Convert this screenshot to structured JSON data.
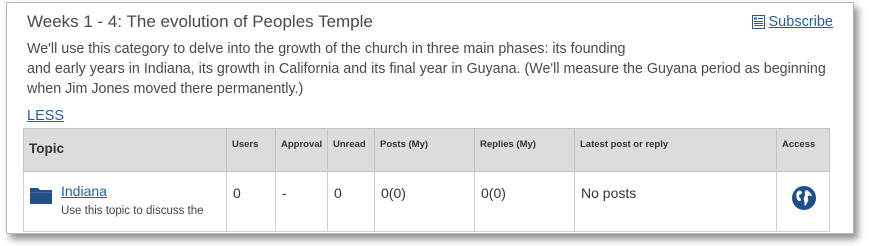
{
  "category": {
    "title": "Weeks 1 - 4: The evolution of Peoples Temple",
    "subscribe_label": "Subscribe",
    "description_lines": [
      "We'll use this category to delve into the growth of the church in three main phases: its founding",
      "and early years in Indiana, its growth in California and its final year in Guyana. (We'll measure the Guyana period as beginning when Jim Jones moved there permanently.)"
    ],
    "less_label": "LESS"
  },
  "table": {
    "headers": {
      "topic": "Topic",
      "users": "Users",
      "approval": "Approval",
      "unread": "Unread",
      "posts": "Posts (My)",
      "replies": "Replies (My)",
      "latest": "Latest post or reply",
      "access": "Access"
    },
    "rows": [
      {
        "name": "Indiana",
        "description": "Use this topic to discuss the",
        "users": "0",
        "approval": "-",
        "unread": "0",
        "posts": "0(0)",
        "replies": "0(0)",
        "latest": "No posts",
        "access_icon": "globe-icon"
      }
    ]
  },
  "colors": {
    "link": "#1f5f9c",
    "folder": "#24508a",
    "header_bg": "#dcdcdc",
    "text": "#4a4a4a"
  }
}
